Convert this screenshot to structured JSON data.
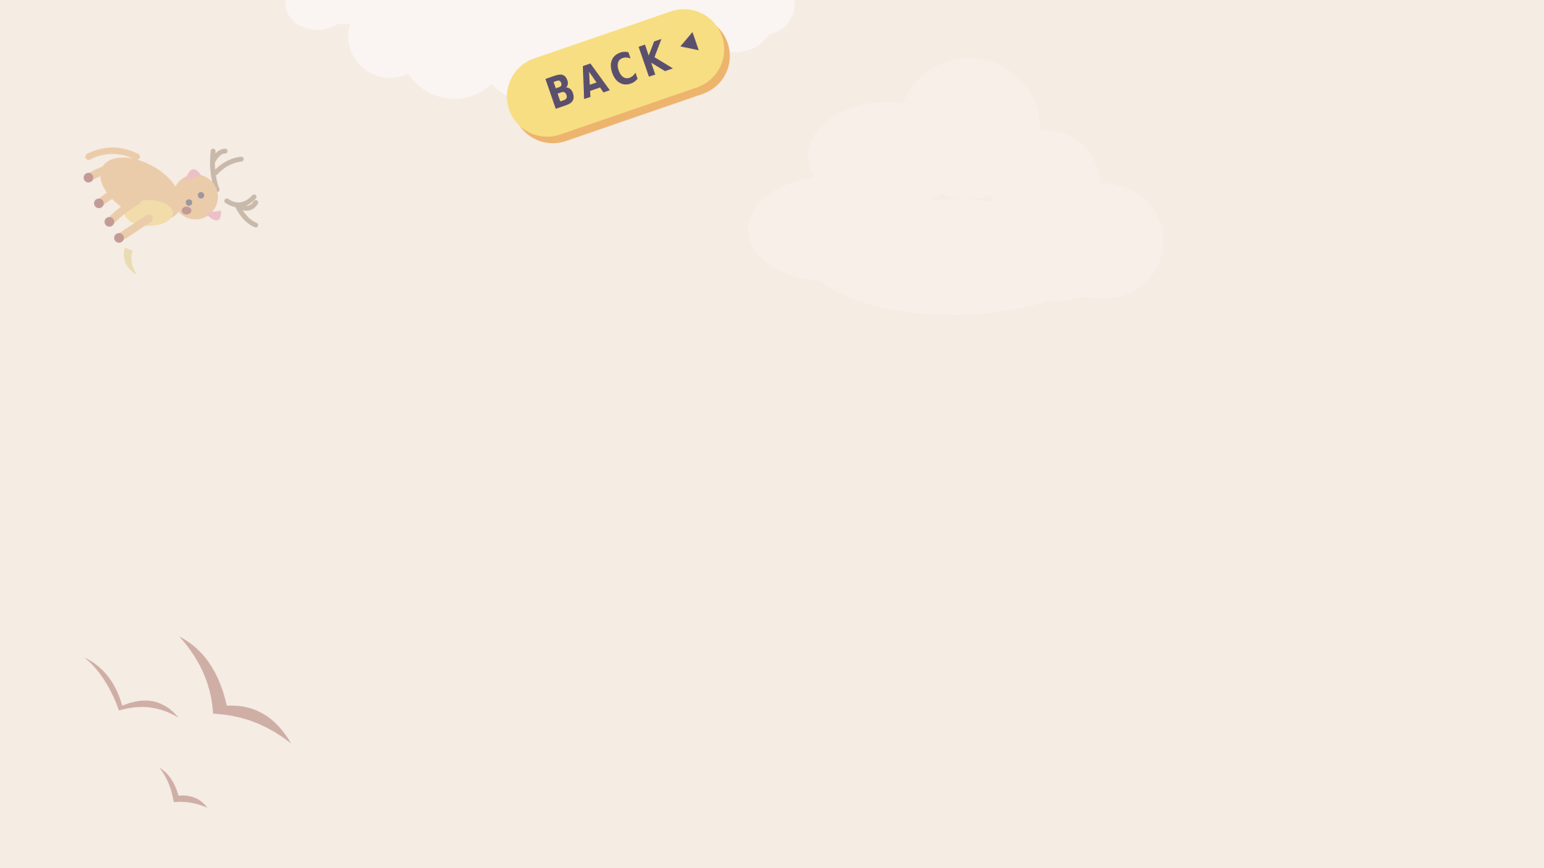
{
  "screen": {
    "background_color": "#f5ece4"
  },
  "back_button": {
    "label": "BACK",
    "icon": "triangle-left-icon",
    "face_color": "#f8de82",
    "shadow_color": "#edb46e",
    "text_color": "#5a4f6d"
  },
  "decorations": {
    "clouds": [
      "top-cloud",
      "right-cloud"
    ],
    "character": "flying-reindeer",
    "birds": [
      "bird-large",
      "bird-medium",
      "bird-small"
    ],
    "bird_color": "#cfaea6"
  }
}
